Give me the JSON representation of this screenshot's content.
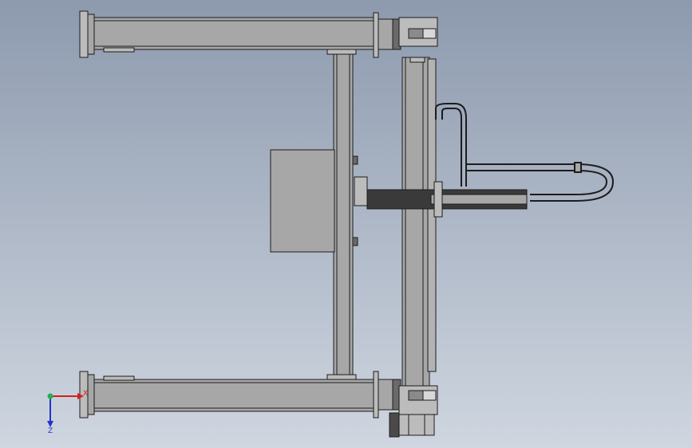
{
  "view": {
    "background_top": "#8d9aae",
    "background_bottom": "#cfd6e0",
    "part_fill": "#a7a7a7",
    "part_fill_light": "#bcbcbc",
    "part_fill_dark": "#4a4a4a",
    "edge_color": "#1c1c1c"
  },
  "triad": {
    "x_label": "X",
    "z_label": "Z",
    "x_color": "#d61f1f",
    "y_color": "#22b14c",
    "z_color": "#2233cc"
  }
}
